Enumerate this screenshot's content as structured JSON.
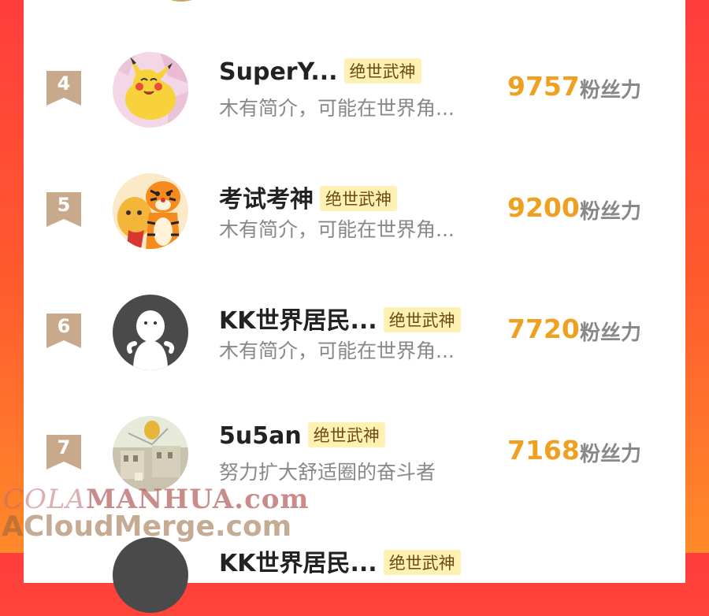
{
  "ranking": [
    {
      "rank": "4",
      "name": "SuperY...",
      "title": "绝世武神",
      "bio": "木有简介，可能在世界角...",
      "fans": "9757",
      "fans_label": "粉丝力",
      "avatar": "pikachu-avatar"
    },
    {
      "rank": "5",
      "name": "考试考神",
      "title": "绝世武神",
      "bio": "木有简介，可能在世界角...",
      "fans": "9200",
      "fans_label": "粉丝力",
      "avatar": "tigger-avatar"
    },
    {
      "rank": "6",
      "name": "KK世界居民...",
      "title": "绝世武神",
      "bio": "木有简介，可能在世界角...",
      "fans": "7720",
      "fans_label": "粉丝力",
      "avatar": "default-avatar"
    },
    {
      "rank": "7",
      "name": "5u5an",
      "title": "绝世武神",
      "bio": "努力扩大舒适圈的奋斗者",
      "fans": "7168",
      "fans_label": "粉丝力",
      "avatar": "photo-avatar"
    },
    {
      "rank": "",
      "name": "KK世界居民...",
      "title": "绝世武神",
      "bio": "",
      "fans": "",
      "fans_label": "",
      "avatar": "default-avatar"
    }
  ],
  "watermark": {
    "line1_a": "COLA",
    "line1_b": "MANHUA.com",
    "line2": "ACloudMerge.com"
  },
  "colors": {
    "fan_count": "#f0a020",
    "title_badge_bg": "#fff0b3",
    "rank_badge": "#c9a98c"
  }
}
